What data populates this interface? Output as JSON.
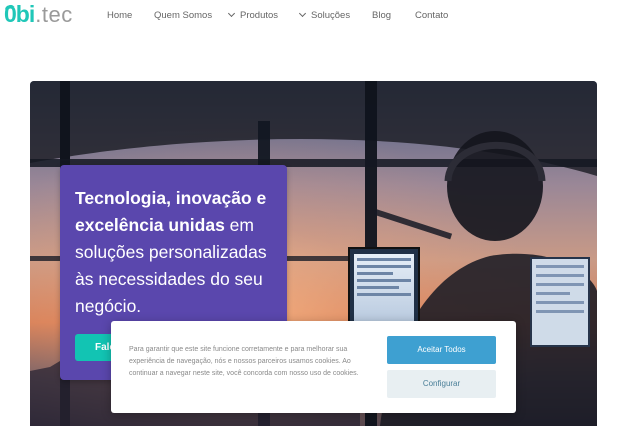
{
  "logo": {
    "mark": "0bi",
    "word": ".tec"
  },
  "nav": [
    {
      "label": "Home",
      "dropdown": false
    },
    {
      "label": "Quem Somos",
      "dropdown": false
    },
    {
      "label": "Produtos",
      "dropdown": true
    },
    {
      "label": "Soluções",
      "dropdown": true
    },
    {
      "label": "Blog",
      "dropdown": false
    },
    {
      "label": "Contato",
      "dropdown": false
    }
  ],
  "hero": {
    "headline_bold": "Tecnologia, inovação e excelência unidas",
    "headline_rest": " em soluções personalizadas às necessidades do seu negócio.",
    "cta_label": "Fale"
  },
  "cookie": {
    "text": "Para garantir que este site funcione corretamente e para melhorar sua experiência de navegação, nós e nossos parceiros usamos cookies. Ao continuar a navegar neste site, você concorda com nosso uso de cookies.",
    "accept_label": "Aceitar Todos",
    "config_label": "Configurar"
  },
  "colors": {
    "brand_teal": "#20c7b8",
    "card_purple": "#5a47ad",
    "cta_teal": "#12c4b3",
    "accept_blue": "#3ea0d1"
  },
  "icons": [
    "chevron-down-icon"
  ]
}
